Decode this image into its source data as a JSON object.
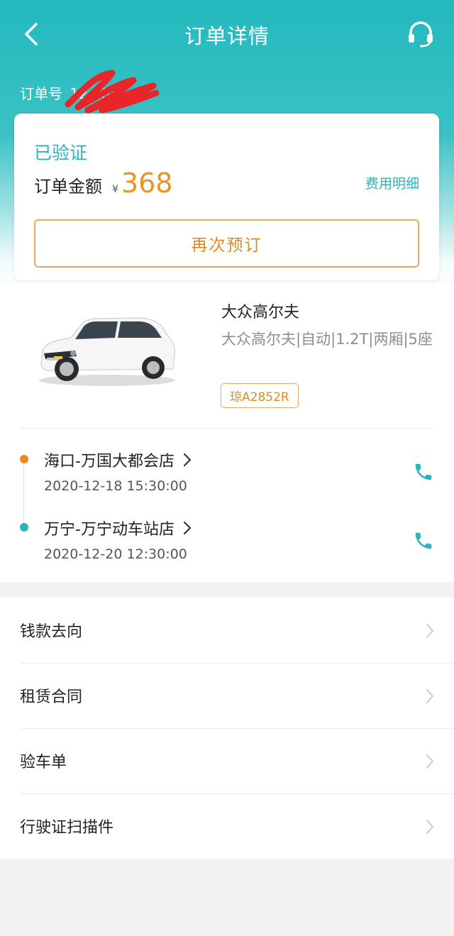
{
  "header": {
    "title": "订单详情",
    "order_no_label": "订单号",
    "order_no_value": "12        985"
  },
  "status": {
    "status_text": "已验证",
    "amount_label": "订单金额",
    "currency": "¥",
    "amount": "368",
    "fee_detail_link": "费用明细",
    "rebook_button": "再次预订"
  },
  "car": {
    "name": "大众高尔夫",
    "spec": "大众高尔夫|自动|1.2T|两厢|5座",
    "plate": "琼A2852R"
  },
  "pickup": {
    "store": "海口-万国大都会店",
    "time": "2020-12-18 15:30:00"
  },
  "return": {
    "store": "万宁-万宁动车站店",
    "time": "2020-12-20 12:30:00"
  },
  "menu": {
    "items": [
      {
        "label": "钱款去向"
      },
      {
        "label": "租赁合同"
      },
      {
        "label": "验车单"
      },
      {
        "label": "行驶证扫描件"
      }
    ]
  },
  "colors": {
    "brand_teal": "#2ab4b8",
    "accent_orange": "#e89522",
    "pickup_dot": "#f08a16"
  },
  "icons": {
    "back": "chevron-left-icon",
    "service": "headset-icon",
    "phone": "phone-icon",
    "chevron": "chevron-right-icon"
  }
}
